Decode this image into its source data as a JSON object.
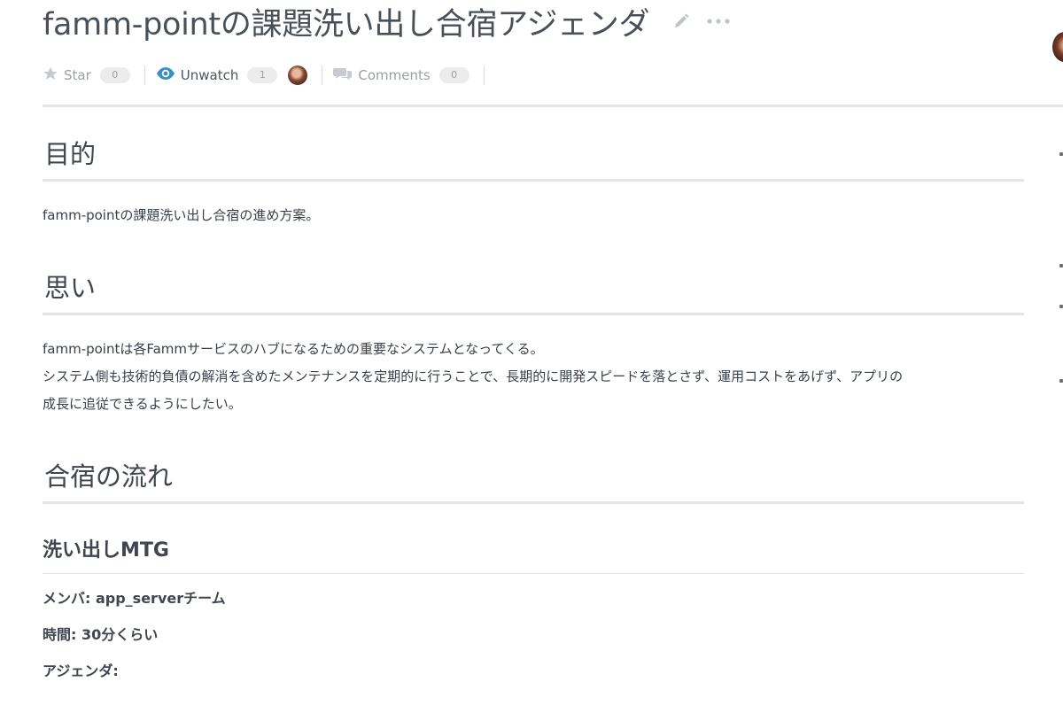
{
  "title": "famm-pointの課題洗い出し合宿アジェンダ",
  "meta": {
    "star_label": "Star",
    "star_count": "0",
    "watch_label": "Unwatch",
    "watch_count": "1",
    "comments_label": "Comments",
    "comments_count": "0"
  },
  "sections": {
    "purpose_heading": "目的",
    "purpose_text": "famm-pointの課題洗い出し合宿の進め方案。",
    "thoughts_heading": "思い",
    "thoughts_line1": "famm-pointは各Fammサービスのハブになるための重要なシステムとなってくる。",
    "thoughts_line2": "システム側も技術的負債の解消を含めたメンテナンスを定期的に行うことで、長期的に開発スピードを落とさず、運用コストをあげず、アプリの",
    "thoughts_line3": "成長に追従できるようにしたい。",
    "flow_heading": "合宿の流れ",
    "mtg_heading": "洗い出しMTG",
    "member_line": "メンバ: app_serverチーム",
    "time_line": "時間: 30分くらい",
    "agenda_line": "アジェンダ:"
  },
  "icons": {
    "edit": "pencil-icon",
    "more": "ellipsis-icon",
    "star": "star-icon",
    "watch": "eye-icon",
    "comments": "comments-icon"
  },
  "colors": {
    "watch_icon": "#3b8fc4",
    "muted_text": "#9aa0a8"
  }
}
